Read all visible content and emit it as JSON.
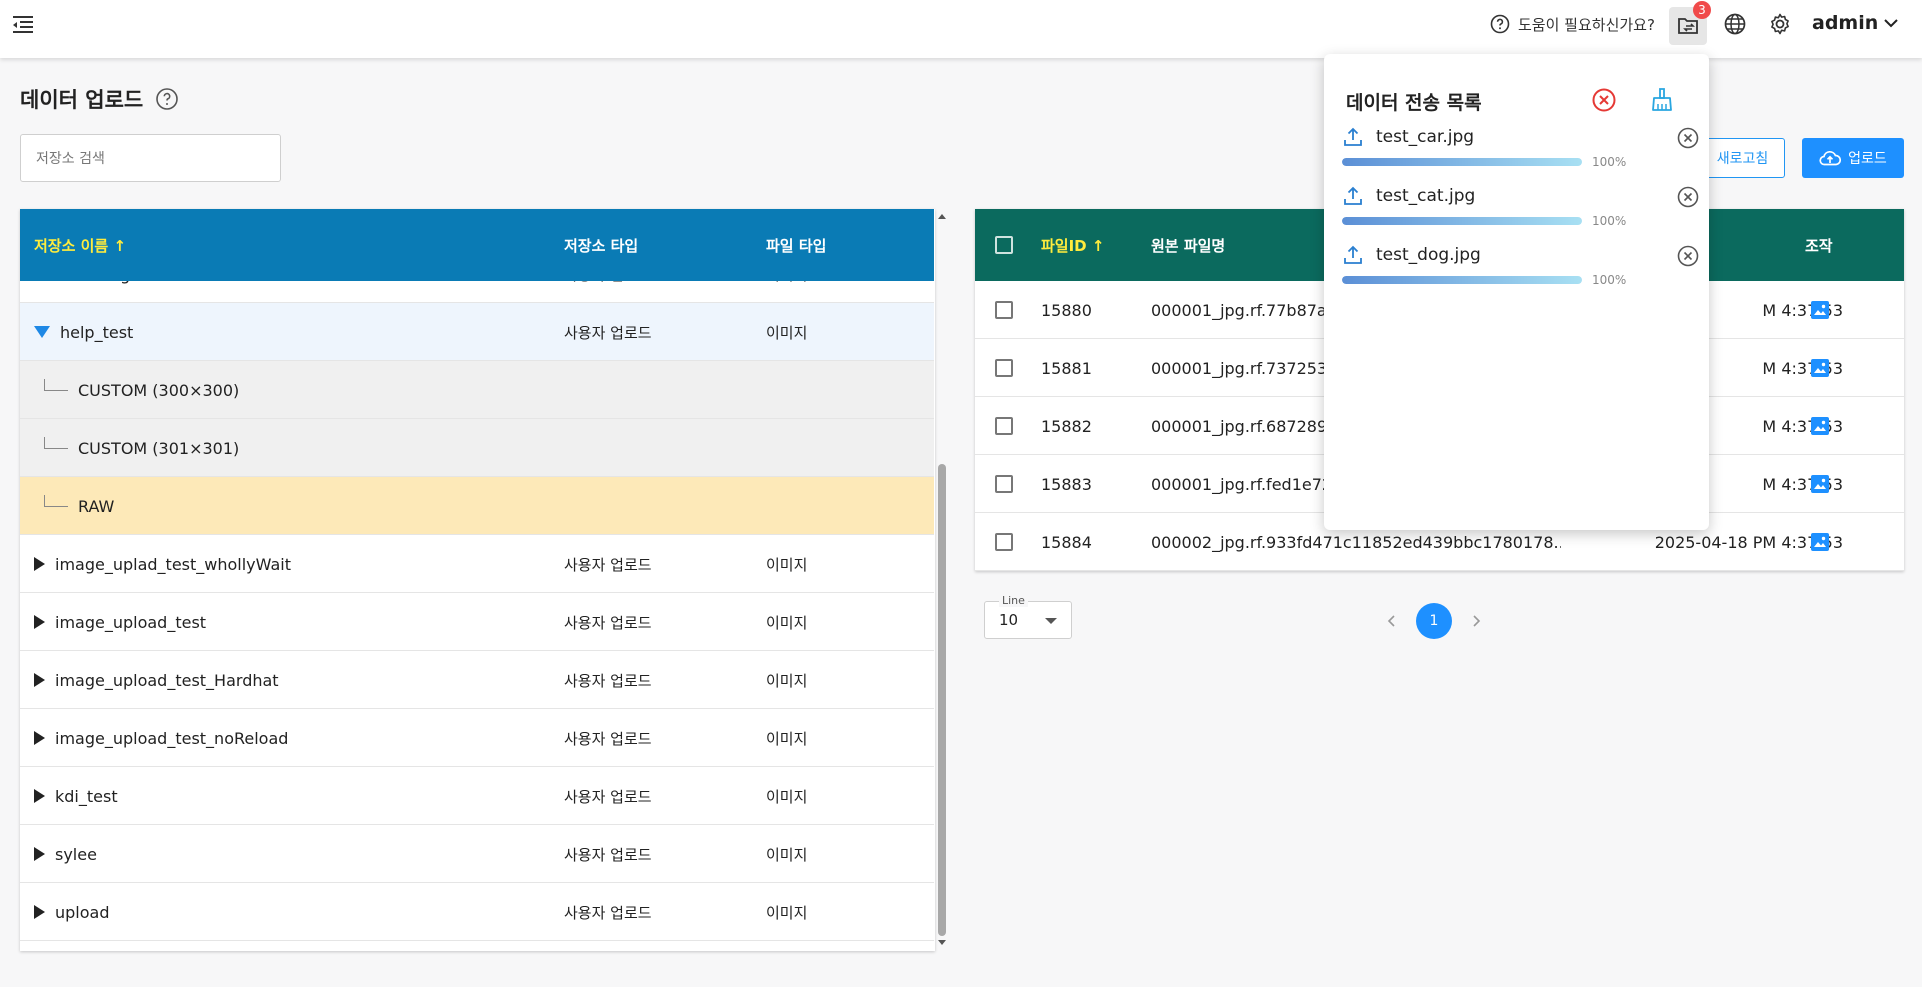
{
  "header": {
    "help_text": "도움이 필요하신가요?",
    "notification_count": "3",
    "user_name": "admin"
  },
  "page": {
    "title": "데이터 업로드",
    "search_placeholder": "저장소 검색"
  },
  "repo_table": {
    "columns": [
      "저장소 이름 ↑",
      "저장소 타입",
      "파일 타입"
    ],
    "rows": [
      {
        "name": "catsNdogs",
        "type": "사용자 업로드",
        "file_type": "이미지"
      },
      {
        "name": "help_test",
        "type": "사용자 업로드",
        "file_type": "이미지"
      },
      {
        "name": "CUSTOM (300×300)",
        "type": "",
        "file_type": ""
      },
      {
        "name": "CUSTOM (301×301)",
        "type": "",
        "file_type": ""
      },
      {
        "name": "RAW",
        "type": "",
        "file_type": ""
      },
      {
        "name": "image_uplad_test_whollyWait",
        "type": "사용자 업로드",
        "file_type": "이미지"
      },
      {
        "name": "image_upload_test",
        "type": "사용자 업로드",
        "file_type": "이미지"
      },
      {
        "name": "image_upload_test_Hardhat",
        "type": "사용자 업로드",
        "file_type": "이미지"
      },
      {
        "name": "image_upload_test_noReload",
        "type": "사용자 업로드",
        "file_type": "이미지"
      },
      {
        "name": "kdi_test",
        "type": "사용자 업로드",
        "file_type": "이미지"
      },
      {
        "name": "sylee",
        "type": "사용자 업로드",
        "file_type": "이미지"
      },
      {
        "name": "upload",
        "type": "사용자 업로드",
        "file_type": "이미지"
      }
    ]
  },
  "file_table": {
    "columns": [
      "파일ID ↑",
      "원본 파일명",
      "조작"
    ],
    "rows": [
      {
        "id": "15880",
        "filename": "000001_jpg.rf.77b87a",
        "date": "M 4:37:53"
      },
      {
        "id": "15881",
        "filename": "000001_jpg.rf.737253",
        "date": "M 4:37:53"
      },
      {
        "id": "15882",
        "filename": "000001_jpg.rf.687289",
        "date": "M 4:37:53"
      },
      {
        "id": "15883",
        "filename": "000001_jpg.rf.fed1e72",
        "date": "M 4:37:53"
      },
      {
        "id": "15884",
        "filename": "000002_jpg.rf.933fd471c11852ed439bbc1780178...",
        "date": "2025-04-18 PM 4:37:53"
      }
    ]
  },
  "actions": {
    "refresh_label": "새로고침",
    "upload_label": "업로드"
  },
  "pagination": {
    "line_label": "Line",
    "line_value": "10",
    "current_page": "1"
  },
  "transfer_popup": {
    "title": "데이터 전송 목록",
    "items": [
      {
        "name": "test_car.jpg",
        "progress": "100%"
      },
      {
        "name": "test_cat.jpg",
        "progress": "100%"
      },
      {
        "name": "test_dog.jpg",
        "progress": "100%"
      }
    ]
  },
  "colors": {
    "repo_header": "#0a7bb5",
    "file_header": "#0b6a5e",
    "accent": "#1e90ff",
    "sort_highlight": "#ffec3d",
    "selected_row": "#fde9b8"
  }
}
